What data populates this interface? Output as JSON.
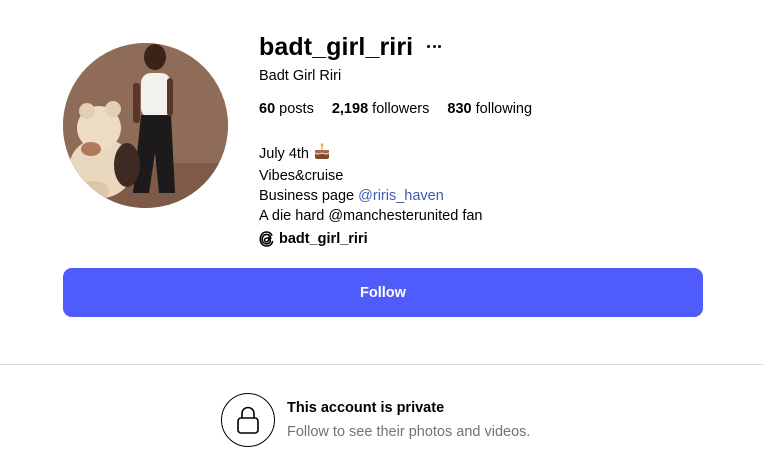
{
  "profile": {
    "username": "badt_girl_riri",
    "display_name": "Badt Girl Riri",
    "stats": {
      "posts_count": "60",
      "posts_label": "posts",
      "followers_count": "2,198",
      "followers_label": "followers",
      "following_count": "830",
      "following_label": "following"
    },
    "bio": {
      "line1": "July 4th",
      "line1_emoji": "cake-icon",
      "line2": "Vibes&cruise",
      "line3_prefix": "Business page ",
      "line3_mention": "@riris_haven",
      "line4": "A die hard @manchesterunited fan",
      "threads_handle": "badt_girl_riri"
    }
  },
  "actions": {
    "follow_label": "Follow"
  },
  "private_notice": {
    "title": "This account is private",
    "subtitle": "Follow to see their photos and videos."
  },
  "colors": {
    "follow_button": "#4f5bfa",
    "mention_link": "#3e5bb5",
    "subtitle_text": "#737373",
    "divider": "#dbdbdb"
  }
}
